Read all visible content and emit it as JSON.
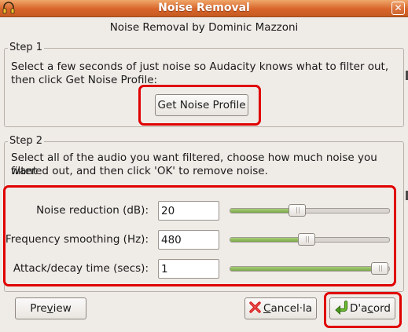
{
  "window": {
    "title": "Noise Removal",
    "close_glyph": "✕",
    "icon": "headphones-icon"
  },
  "header": {
    "text": "Noise Removal by Dominic Mazzoni"
  },
  "step1": {
    "legend": "Step 1",
    "description_line1": "Select a few seconds of just noise so Audacity knows what to filter out,",
    "description_line2": "then click Get Noise Profile:",
    "button_label": "Get Noise Profile"
  },
  "step2": {
    "legend": "Step 2",
    "description_line1": "Select all of the audio you want filtered, choose how much noise you want",
    "description_line2": "filtered out, and then click 'OK' to remove noise.",
    "params": [
      {
        "label": "Noise reduction (dB):",
        "value": "20",
        "slider_fraction": 0.42
      },
      {
        "label": "Frequency smoothing (Hz):",
        "value": "480",
        "slider_fraction": 0.48
      },
      {
        "label": "Attack/decay time (secs):",
        "value": "1",
        "slider_fraction": 0.94
      }
    ]
  },
  "footer": {
    "preview_pre": "Pre",
    "preview_ul": "v",
    "preview_post": "iew",
    "cancel_ul": "C",
    "cancel_post": "ancel·la",
    "ok_pre": "D'a",
    "ok_ul": "c",
    "ok_post": "ord"
  },
  "colors": {
    "titlebar": "#d8642a",
    "highlight": "#e00000",
    "slider_fill": "#7aa74a"
  }
}
